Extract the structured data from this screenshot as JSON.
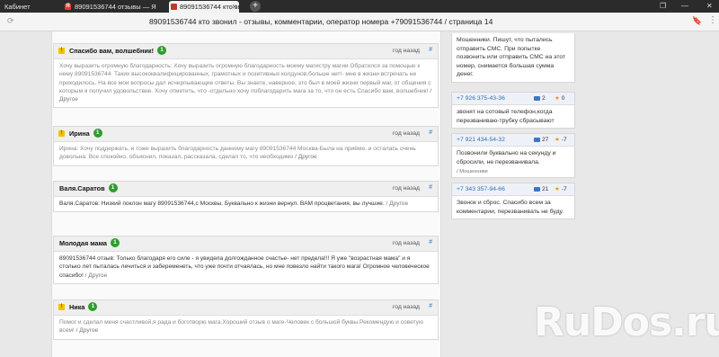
{
  "browser": {
    "tabs": [
      {
        "label": "Кабинет"
      },
      {
        "label": "89091536744 отзывы — Я"
      },
      {
        "label": "89091536744 кто зв"
      }
    ],
    "new_tab": "+",
    "page_title": "89091536744 кто звонил - отзывы, комментарии, оператор номера +79091536744 / страница 14"
  },
  "reviews": [
    {
      "name": "Спасибо вам, волшебник!",
      "badge": "1",
      "ago": "год назад",
      "hash": "#",
      "text": "Хочу выразить огромную благодарность: Хочу выразить огромную благодарность моему магистру магии Обратился за помощью к нему 89091536744. Таких высококвалифицированных, грамотных и позитивных колдунов,больше нет!- мне в жизни встречать не приходилось. На все мои вопросы дал исчерпывающие ответы. Вы знаете, наверное, это был в моей жизни первый маг, от общения с которым я получил удовольствие. Хочу отметить, что -отдельно хочу поблагодарить мага за то, что он есть Спасибо вам, волшебник!",
      "other": "/ Другое"
    },
    {
      "name": "Ирина",
      "badge": "1",
      "ago": "год назад",
      "hash": "#",
      "text": "Ирина: Хочу поддержать, и тоже выразить благодарность данному магу 89091536744 Москва-Была на приёме, и осталась очень довольна. Все спокойно, объяснил, показал, рассказала, сделал то, что необходимо",
      "other": "/ Другое"
    },
    {
      "name": "Валя.Саратов",
      "badge": "1",
      "ago": "год назад",
      "hash": "#",
      "text": "Валя.Саратов: Низкий поклон магу 89091536744,с Москвы. Буквально к жизни вернул. ВАМ процветания, вы лучшие.",
      "other": "/ Другое"
    },
    {
      "name": "Молодая мама",
      "badge": "1",
      "ago": "год назад",
      "hash": "#",
      "text": "89091536744 отзыв: Только благодаря его силе - я увидела долгожданное счастье- нет предела!!! Я уже \"возрастная мама\" и я столько лет пыталась лечиться и забеременеть, что уже почти отчаялась, но мне повезло найти такого мага! Огромное человеческое спасибо!",
      "other": "/ Другое"
    },
    {
      "name": "Ника",
      "badge": "1",
      "ago": "год назад",
      "hash": "#",
      "text": "Помог и сделал меня счастливой,я рада и боготворю мага.Хороший отзыв о маге-Человек с большой буквы.Рекомендую и советую всем!",
      "other": "/ Другое"
    }
  ],
  "sidebar": [
    {
      "text": "Мошенники. Пишут, что пытались отправить СМС. При попытке позвонить или отправить СМС на этот номер, снимается большая сумма денег."
    },
    {
      "phone": "+7 926 375-43-36",
      "comments": "2",
      "star": "★",
      "rating": "0",
      "text": "звонят на сотовый телефон,когда перезваниваю-трубку сбрасывают"
    },
    {
      "phone": "+7 921 434-54-32",
      "comments": "27",
      "star": "★",
      "rating": "-7",
      "text": "Позвонили буквально на секунду и сбросили, не перезванивала.",
      "tag": "/ Мошенники"
    },
    {
      "phone": "+7 343 357-94-66",
      "comments": "21",
      "star": "★",
      "rating": "-7",
      "text": "Звонок и сброс. Спасибо всем за комментарии, перезванивать не буду."
    }
  ],
  "watermark": "RuDos.ru",
  "colors": {
    "badge": "#2e9d2e",
    "link": "#2f6fb5",
    "star": "#f0932b",
    "warning_icon": "#f2c200"
  }
}
